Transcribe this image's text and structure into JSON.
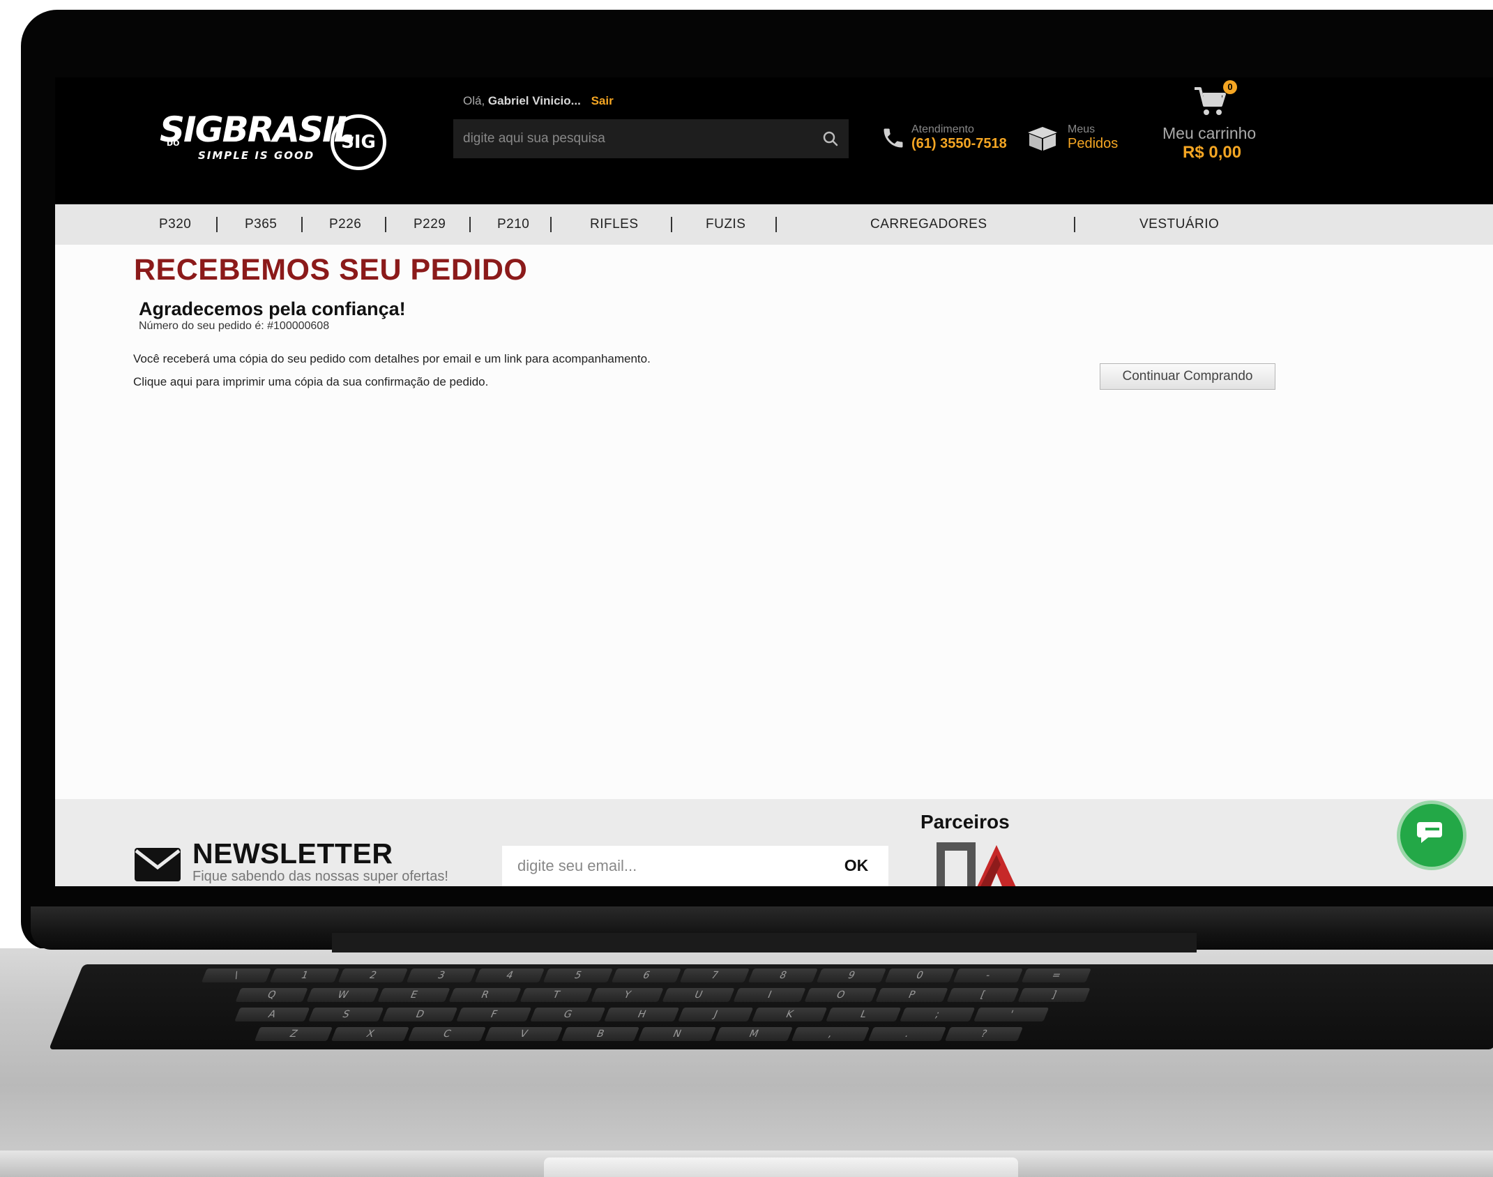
{
  "header": {
    "logo_text": "SIGBRASIL",
    "logo_prefix": "DO",
    "logo_tagline": "SIMPLE IS GOOD",
    "logo_seal_text": "SIG",
    "greeting_prefix": "Olá,",
    "user_name": "Gabriel Vinicio...",
    "logout_label": "Sair",
    "search_placeholder": "digite aqui sua pesquisa",
    "support_label": "Atendimento",
    "support_phone": "(61) 3550-7518",
    "orders_label_top": "Meus",
    "orders_label_bottom": "Pedidos",
    "cart_label": "Meu carrinho",
    "cart_total": "R$ 0,00",
    "cart_count": "0"
  },
  "nav": {
    "items": [
      "P320",
      "P365",
      "P226",
      "P229",
      "P210",
      "RIFLES",
      "FUZIS",
      "CARREGADORES",
      "VESTUÁRIO"
    ],
    "separator": "|"
  },
  "main": {
    "title": "RECEBEMOS SEU PEDIDO",
    "thanks": "Agradecemos pela confiança!",
    "order_number": "Número do seu pedido é: #100000608",
    "email_note": "Você receberá uma cópia do seu pedido com detalhes por email e um link para acompanhamento.",
    "print_note": "Clique aqui para imprimir uma cópia da sua confirmação de pedido.",
    "continue_button": "Continuar Comprando"
  },
  "footer": {
    "newsletter_title": "NEWSLETTER",
    "newsletter_subtitle": "Fique sabendo das nossas super ofertas!",
    "email_placeholder": "digite seu email...",
    "ok_button": "OK",
    "partners_title": "Parceiros"
  },
  "keyboard": {
    "row1": [
      "\\",
      "1",
      "2",
      "3",
      "4",
      "5",
      "6",
      "7",
      "8",
      "9",
      "0",
      "-",
      "="
    ],
    "row2": [
      "Q",
      "W",
      "E",
      "R",
      "T",
      "Y",
      "U",
      "I",
      "O",
      "P",
      "[",
      "]"
    ],
    "row3": [
      "A",
      "S",
      "D",
      "F",
      "G",
      "H",
      "J",
      "K",
      "L",
      ";",
      "'"
    ],
    "row4": [
      "Z",
      "X",
      "C",
      "V",
      "B",
      "N",
      "M",
      ",",
      ".",
      "?"
    ]
  },
  "colors": {
    "accent": "#f5a623",
    "title_red": "#8b1a1a",
    "chat_green": "#23a847"
  },
  "icons": [
    "search-icon",
    "phone-icon",
    "box-icon",
    "cart-icon",
    "mail-icon",
    "chat-icon"
  ]
}
